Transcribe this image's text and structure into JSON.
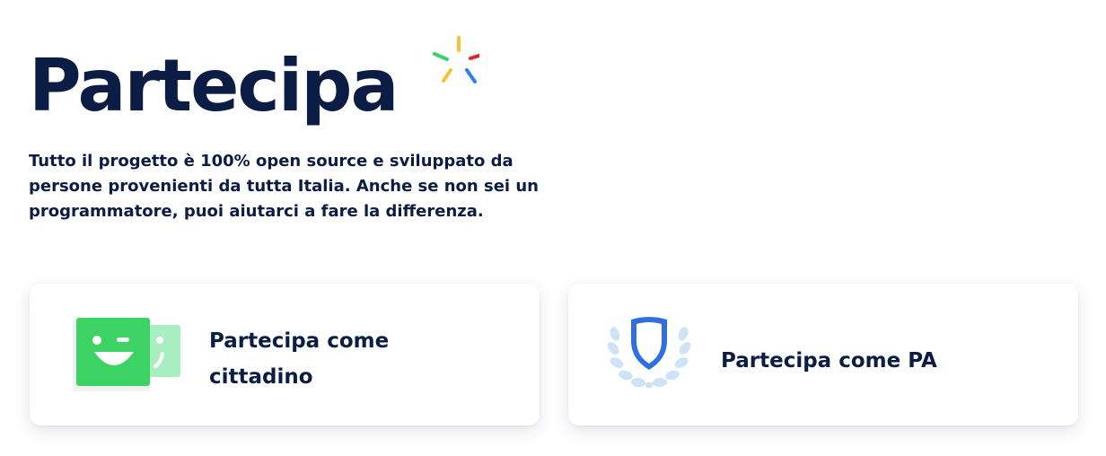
{
  "hero": {
    "title": "Partecipa",
    "description": "Tutto il progetto è 100% open source e sviluppato da persone provenienti da tutta Italia. Anche se non sei un programmatore, puoi aiutarci a fare la differenza."
  },
  "colors": {
    "text": "#0b1d44",
    "sparkle_yellow": "#f5c33b",
    "sparkle_red": "#e8212d",
    "sparkle_green": "#3fcf6c",
    "sparkle_blue": "#2f80ed",
    "citizen_green": "#3cd264",
    "citizen_light_green": "#a8eec1",
    "pa_blue": "#2f6fe0",
    "pa_light_blue": "#cfe3f7"
  },
  "cards": [
    {
      "label": "Partecipa come cittadino",
      "icon": "citizen-face-icon"
    },
    {
      "label": "Partecipa come PA",
      "icon": "shield-laurel-icon"
    }
  ]
}
